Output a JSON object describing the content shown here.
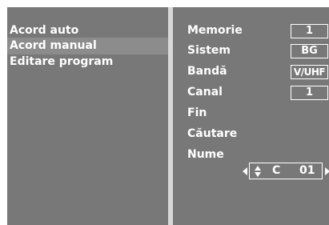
{
  "menu": {
    "items": [
      {
        "label": "Acord auto"
      },
      {
        "label": "Acord manual"
      },
      {
        "label": "Editare program"
      }
    ],
    "selected_index": 1
  },
  "settings": {
    "memorie": {
      "label": "Memorie",
      "value": "1"
    },
    "sistem": {
      "label": "Sistem",
      "value": "BG"
    },
    "banda": {
      "label": "Bandă",
      "value": "V/UHF"
    },
    "canal": {
      "label": "Canal",
      "value": "1"
    },
    "fin": {
      "label": "Fin"
    },
    "cautare": {
      "label": "Căutare"
    },
    "nume": {
      "label": "Nume",
      "letter": "C",
      "number": "01"
    }
  },
  "colors": {
    "panel": "#787878",
    "highlight": "#8c8c8c",
    "text": "#ffffff",
    "divider": "#d8d8d8"
  }
}
